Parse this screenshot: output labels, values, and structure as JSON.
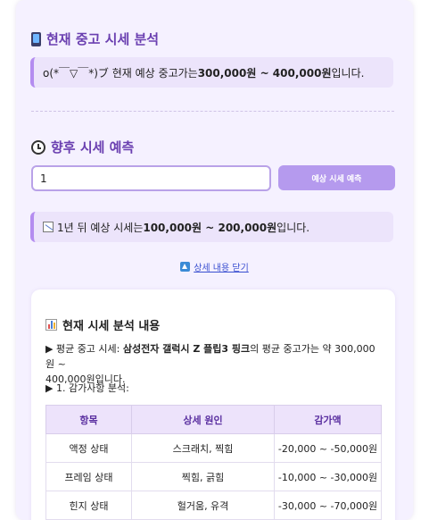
{
  "current_section": {
    "title": "현재 중고 시세 분석",
    "icon": "mobile-phone-icon",
    "result_prefix": "o(*￣▽￣*)ブ 현재 예상 중고가는 ",
    "result_range": "300,000원 ~ 400,000원",
    "result_suffix": "입니다."
  },
  "forecast_section": {
    "title": "향후 시세 예측",
    "icon": "clock-icon",
    "input_value": "1",
    "button_label": "예상 시세 예측",
    "result_prefix": "1년 뒤 예상 시세는 ",
    "result_range": "100,000원 ~ 200,000원",
    "result_suffix": "입니다.",
    "result_icon": "chart-decreasing-icon"
  },
  "toggle": {
    "label": "상세 내용 닫기",
    "icon": "up-arrow-icon"
  },
  "details": {
    "title": "현재 시세 분석 내용",
    "icon": "bar-chart-icon",
    "avg_prefix": "▶ 평균 중고 시세: ",
    "avg_model": "삼성전자 갤럭시 Z 플립3 핑크",
    "avg_suffix_1": "의 평균 중고가는 약 300,000원 ~",
    "avg_suffix_2": "400,000원입니다.",
    "deduction_heading": "▶ 1. 감가사항 분석:",
    "table": {
      "headers": [
        "항목",
        "상세 원인",
        "감가액"
      ],
      "rows": [
        [
          "액정 상태",
          "스크래치, 찍힘",
          "-20,000 ~ -50,000원"
        ],
        [
          "프레임 상태",
          "찍힘, 긁힘",
          "-10,000 ~ -30,000원"
        ],
        [
          "힌지 상태",
          "헐거움, 유격",
          "-30,000 ~ -70,000원"
        ]
      ]
    }
  },
  "colors": {
    "accent": "#6a3fb0",
    "button": "#b59aee",
    "panel_bg": "#f5f1ff",
    "box_bg": "#ece4fb",
    "box_border": "#b48cf0"
  }
}
